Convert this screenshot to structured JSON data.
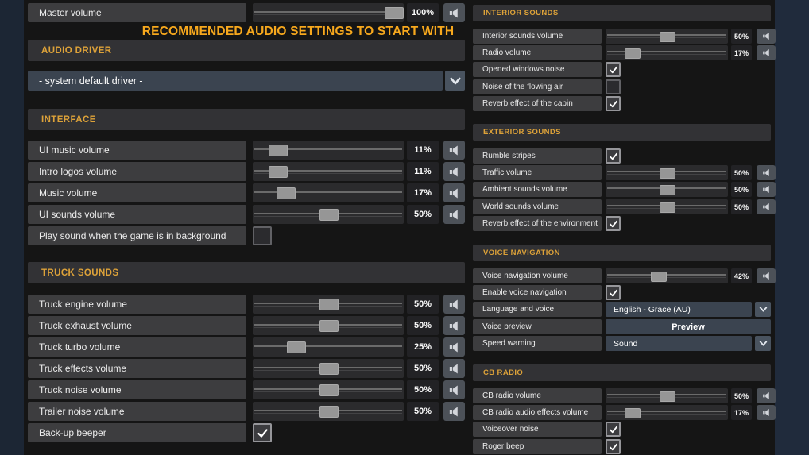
{
  "title": "RECOMMENDED AUDIO SETTINGS TO START WITH",
  "master_row": {
    "type": "slider",
    "label": "Master volume",
    "value": "100%",
    "pct": 100
  },
  "audio_driver": {
    "header": "AUDIO DRIVER",
    "selected": "- system default driver -"
  },
  "left_sections": [
    {
      "header": "INTERFACE",
      "rows": [
        {
          "type": "slider",
          "label": "UI music volume",
          "value": "11%",
          "pct": 11
        },
        {
          "type": "slider",
          "label": "Intro logos volume",
          "value": "11%",
          "pct": 11
        },
        {
          "type": "slider",
          "label": "Music volume",
          "value": "17%",
          "pct": 17
        },
        {
          "type": "slider",
          "label": "UI sounds volume",
          "value": "50%",
          "pct": 50
        },
        {
          "type": "checkbox",
          "label": "Play sound when the game is in background",
          "checked": false
        }
      ]
    },
    {
      "header": "TRUCK SOUNDS",
      "rows": [
        {
          "type": "slider",
          "label": "Truck engine volume",
          "value": "50%",
          "pct": 50
        },
        {
          "type": "slider",
          "label": "Truck exhaust volume",
          "value": "50%",
          "pct": 50
        },
        {
          "type": "slider",
          "label": "Truck turbo volume",
          "value": "25%",
          "pct": 25
        },
        {
          "type": "slider",
          "label": "Truck effects volume",
          "value": "50%",
          "pct": 50
        },
        {
          "type": "slider",
          "label": "Truck noise volume",
          "value": "50%",
          "pct": 50
        },
        {
          "type": "slider",
          "label": "Trailer noise volume",
          "value": "50%",
          "pct": 50
        },
        {
          "type": "checkbox",
          "label": "Back-up beeper",
          "checked": true
        }
      ]
    }
  ],
  "right_sections": [
    {
      "header": "INTERIOR SOUNDS",
      "rows": [
        {
          "type": "slider",
          "label": "Interior sounds volume",
          "value": "50%",
          "pct": 50
        },
        {
          "type": "slider",
          "label": "Radio volume",
          "value": "17%",
          "pct": 17
        },
        {
          "type": "checkbox",
          "label": "Opened windows noise",
          "checked": true
        },
        {
          "type": "checkbox",
          "label": "Noise of the flowing air",
          "checked": false
        },
        {
          "type": "checkbox",
          "label": "Reverb effect of the cabin",
          "checked": true
        }
      ]
    },
    {
      "header": "EXTERIOR SOUNDS",
      "rows": [
        {
          "type": "checkbox",
          "label": "Rumble stripes",
          "checked": true
        },
        {
          "type": "slider",
          "label": "Traffic volume",
          "value": "50%",
          "pct": 50
        },
        {
          "type": "slider",
          "label": "Ambient sounds volume",
          "value": "50%",
          "pct": 50
        },
        {
          "type": "slider",
          "label": "World sounds volume",
          "value": "50%",
          "pct": 50
        },
        {
          "type": "checkbox",
          "label": "Reverb effect of the environment",
          "checked": true
        }
      ]
    },
    {
      "header": "VOICE NAVIGATION",
      "rows": [
        {
          "type": "slider",
          "label": "Voice navigation volume",
          "value": "42%",
          "pct": 42
        },
        {
          "type": "checkbox",
          "label": "Enable voice navigation",
          "checked": true
        },
        {
          "type": "dropdown",
          "label": "Language and voice",
          "selected": "English - Grace (AU)"
        },
        {
          "type": "button",
          "label": "Voice preview",
          "button_label": "Preview"
        },
        {
          "type": "dropdown",
          "label": "Speed warning",
          "selected": "Sound"
        }
      ]
    },
    {
      "header": "CB RADIO",
      "rows": [
        {
          "type": "slider",
          "label": "CB radio volume",
          "value": "50%",
          "pct": 50
        },
        {
          "type": "slider",
          "label": "CB radio audio effects volume",
          "value": "17%",
          "pct": 17
        },
        {
          "type": "checkbox",
          "label": "Voiceover noise",
          "checked": true
        },
        {
          "type": "checkbox",
          "label": "Roger beep",
          "checked": true
        }
      ]
    }
  ],
  "colors": {
    "section_header_text": "#dda239",
    "title_text": "#f7a81d",
    "panel_bg": "#151515",
    "side_strip": "#202b3c",
    "label_box": "#3d3d3f",
    "dropdown_box": "#3b4450",
    "slider_thumb": "#969696"
  },
  "icons": {
    "speaker": "speaker-icon",
    "chevron": "chevron-down-icon",
    "check": "check-icon"
  }
}
